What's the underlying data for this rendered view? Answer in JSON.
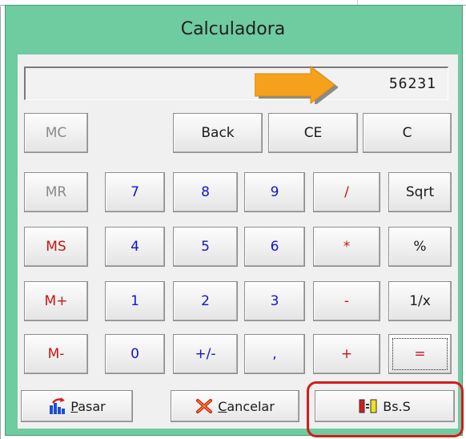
{
  "window": {
    "title": "Calculadora"
  },
  "display": {
    "value": "56231"
  },
  "buttons": {
    "mc": "MC",
    "back": "Back",
    "ce": "CE",
    "c": "C",
    "mr": "MR",
    "n7": "7",
    "n8": "8",
    "n9": "9",
    "div": "/",
    "sqrt": "Sqrt",
    "ms": "MS",
    "n4": "4",
    "n5": "5",
    "n6": "6",
    "mul": "*",
    "pct": "%",
    "mplus": "M+",
    "n1": "1",
    "n2": "2",
    "n3": "3",
    "sub": "-",
    "inv": "1/x",
    "mminus": "M-",
    "n0": "0",
    "sign": "+/-",
    "dec": ",",
    "add": "+",
    "eq": "="
  },
  "actions": {
    "pasar": {
      "first": "P",
      "rest": "asar",
      "icon": "bar-chart-icon"
    },
    "cancelar": {
      "first": "C",
      "rest": "ancelar",
      "icon": "red-x-icon"
    },
    "bss": {
      "label": "Bs.S",
      "icon": "currency-convert-icon"
    }
  },
  "colors": {
    "window_bg": "#6fcba0",
    "digit": "#1414c8",
    "operator": "#c81414",
    "memory_disabled": "#8a8a8a",
    "arrow": "#f5a11c",
    "highlight": "#d41c1c"
  }
}
